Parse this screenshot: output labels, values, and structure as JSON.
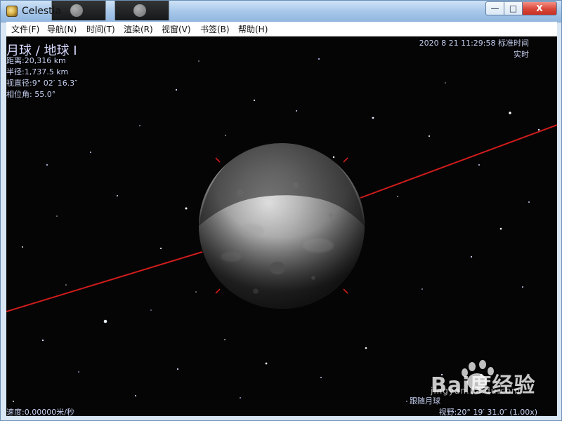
{
  "window": {
    "title": "Celestia",
    "controls": {
      "minimize": "—",
      "maximize": "□",
      "close": "X"
    }
  },
  "menu": {
    "items": [
      {
        "label": "文件(F)"
      },
      {
        "label": "导航(N)"
      },
      {
        "label": "时间(T)"
      },
      {
        "label": "渲染(R)"
      },
      {
        "label": "视窗(V)"
      },
      {
        "label": "书签(B)"
      },
      {
        "label": "帮助(H)"
      }
    ]
  },
  "hud": {
    "object_name": "月球 / 地球 I",
    "distance": "距离:20,316 km",
    "radius": "半径:1,737.5 km",
    "angular_size": "视直径:9° 02′ 16.3″",
    "phase": "相位角: 55.0°",
    "time_main": "2020 8 21 11:29:58 标准时间",
    "time_sub": "实时",
    "speed": "速度:0.00000米/秒",
    "mode": "跟随月球",
    "fov": "视野:20° 19′ 31.0″ (1.00x)"
  },
  "watermark": {
    "text": "Bai度经验",
    "subtext": "jingyan.baidu.com"
  },
  "icons": {
    "app": "celestia-app-icon",
    "minimize": "minimize-icon",
    "maximize": "maximize-icon",
    "close": "close-icon",
    "target": "target-marker-icon"
  },
  "colors": {
    "scene_background": "#050505",
    "hud_text": "#c6d0f0",
    "orbit_line": "#d11c1c",
    "title_bar": "#a8c8ea",
    "close_button": "#d9473a"
  }
}
